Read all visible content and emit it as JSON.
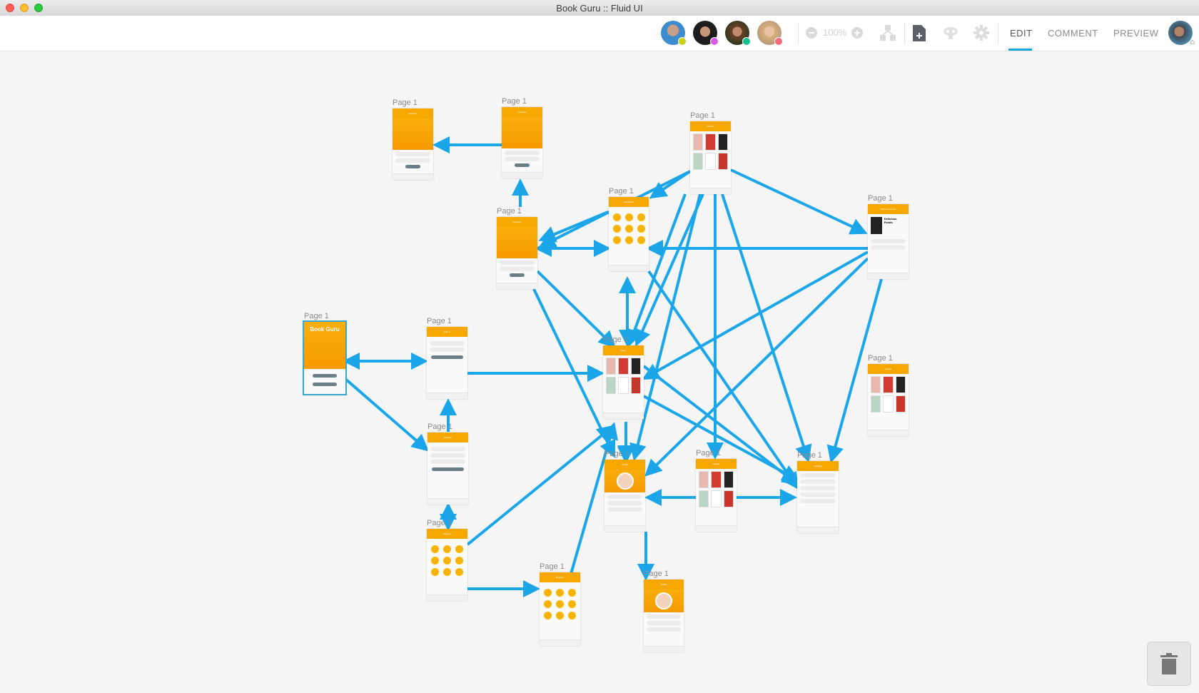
{
  "window": {
    "title": "Book Guru :: Fluid UI"
  },
  "toolbar": {
    "collaborators": [
      {
        "name": "collaborator-1",
        "status_color": "#c7d21a"
      },
      {
        "name": "collaborator-2",
        "status_color": "#d65ce6"
      },
      {
        "name": "collaborator-3",
        "status_color": "#15c08b"
      },
      {
        "name": "collaborator-4",
        "status_color": "#f46a7a"
      }
    ],
    "zoom_level": "100%",
    "icons": [
      "zoom-out-icon",
      "zoom-in-icon",
      "sitemap-icon",
      "add-page-icon",
      "widget-library-icon",
      "settings-icon"
    ],
    "tabs": [
      {
        "label": "EDIT",
        "active": true
      },
      {
        "label": "COMMENT",
        "active": false
      },
      {
        "label": "PREVIEW",
        "active": false
      }
    ],
    "accent_color": "#1aa6dc"
  },
  "screens": [
    {
      "id": "s1",
      "label": "Page 1",
      "title": "Compare",
      "kind": "compare"
    },
    {
      "id": "s2",
      "label": "Page 1",
      "title": "Compare",
      "kind": "compare"
    },
    {
      "id": "s3",
      "label": "Page 1",
      "title": "Genres",
      "kind": "genres"
    },
    {
      "id": "s4",
      "label": "Page 1",
      "title": "Categories",
      "kind": "categories"
    },
    {
      "id": "s5",
      "label": "Page 1",
      "title": "Compare",
      "kind": "compare"
    },
    {
      "id": "s6",
      "label": "Page 1",
      "title": "Delicious Foods",
      "kind": "detail"
    },
    {
      "id": "s7",
      "label": "Page 1",
      "title": "Book Guru",
      "kind": "splash",
      "selected": true
    },
    {
      "id": "s8",
      "label": "Page 1",
      "title": "Sign in",
      "kind": "signin"
    },
    {
      "id": "s9",
      "label": "Page 1",
      "title": "Feed",
      "kind": "feed"
    },
    {
      "id": "s10",
      "label": "Page 1",
      "title": "Genres",
      "kind": "genres"
    },
    {
      "id": "s11",
      "label": "Page 1",
      "title": "Register",
      "kind": "register"
    },
    {
      "id": "s12",
      "label": "Page 1",
      "title": "Profile",
      "kind": "profile"
    },
    {
      "id": "s13",
      "label": "Page 1",
      "title": "Genres",
      "kind": "genres"
    },
    {
      "id": "s14",
      "label": "Page 1",
      "title": "Settings",
      "kind": "settings"
    },
    {
      "id": "s15",
      "label": "Page 1",
      "title": "Register",
      "kind": "categories"
    },
    {
      "id": "s16",
      "label": "Page 1",
      "title": "Register",
      "kind": "categories"
    },
    {
      "id": "s17",
      "label": "Page 1",
      "title": "Profile",
      "kind": "profile"
    }
  ],
  "links_color": "#1aa6e8",
  "trash": {
    "icon": "trash-icon"
  }
}
